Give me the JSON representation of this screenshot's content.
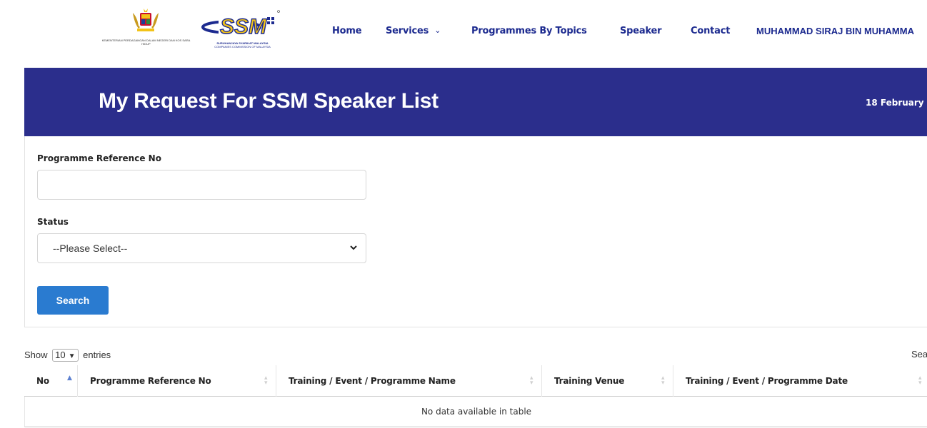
{
  "header": {
    "kpdn_logo_caption": "KEMENTERIAN PERDAGANGAN DALAM NEGERI DAN KOS SARA HIDUP",
    "ssm_logo_text": "SSM",
    "ssm_logo_caption": "SURUHANJAYA SYARIKAT MALAYSIA",
    "ssm_logo_subcaption": "COMPANIES COMMISSION OF MALAYSIA",
    "nav": [
      {
        "label": "Home"
      },
      {
        "label": "Services"
      },
      {
        "label": "Programmes By Topics"
      },
      {
        "label": "Speaker"
      },
      {
        "label": "Contact"
      }
    ],
    "user_name": "MUHAMMAD SIRAJ BIN MUHAMMA"
  },
  "banner": {
    "title": "My Request For SSM Speaker List",
    "date": "18 February"
  },
  "form": {
    "ref_label": "Programme Reference No",
    "ref_value": "",
    "status_label": "Status",
    "status_selected": "--Please Select--",
    "search_label": "Search"
  },
  "table": {
    "show_prefix": "Show",
    "page_length": "10",
    "show_suffix": "entries",
    "search_label": "Sea",
    "columns": [
      "No",
      "Programme Reference No",
      "Training / Event / Programme Name",
      "Training Venue",
      "Training / Event / Programme Date"
    ],
    "empty_message": "No data available in table"
  },
  "colors": {
    "brand_blue": "#1c2a8f",
    "banner_bg": "#2b2e8c",
    "button_bg": "#2a7bd0"
  },
  "icons": {
    "services_dropdown": "chevron-down-icon",
    "status_dropdown": "chevron-down-icon",
    "sort": "sort-icon"
  }
}
